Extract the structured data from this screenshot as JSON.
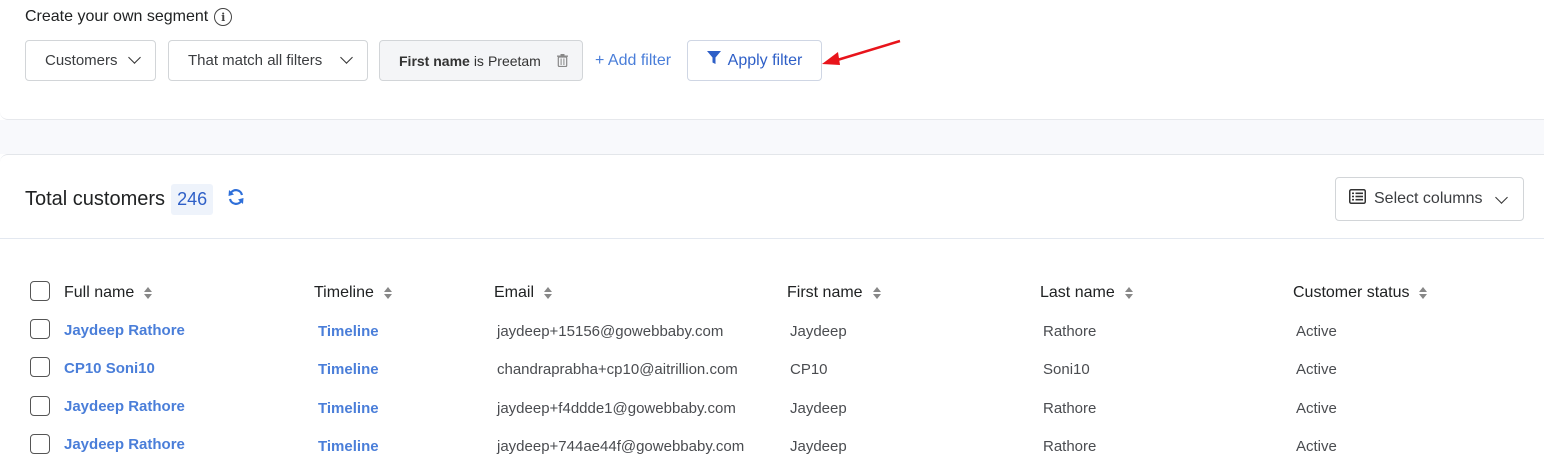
{
  "segment": {
    "title": "Create your own segment",
    "info_icon": "info-icon",
    "entity_dropdown": "Customers",
    "match_dropdown": "That match all filters",
    "filter_chip": {
      "field": "First name",
      "operator": "is",
      "value": "Preetam"
    },
    "add_filter": "+ Add filter",
    "apply_filter": "Apply filter"
  },
  "customers": {
    "title": "Total customers",
    "count": "246",
    "select_columns": "Select columns"
  },
  "table": {
    "headers": [
      "Full name",
      "Timeline",
      "Email",
      "First name",
      "Last name",
      "Customer status"
    ],
    "rows": [
      {
        "full_name": "Jaydeep Rathore",
        "timeline": "Timeline",
        "email": "jaydeep+15156@gowebbaby.com",
        "first_name": "Jaydeep",
        "last_name": "Rathore",
        "status": "Active"
      },
      {
        "full_name": "CP10 Soni10",
        "timeline": "Timeline",
        "email": "chandraprabha+cp10@aitrillion.com",
        "first_name": "CP10",
        "last_name": "Soni10",
        "status": "Active"
      },
      {
        "full_name": "Jaydeep Rathore",
        "timeline": "Timeline",
        "email": "jaydeep+f4ddde1@gowebbaby.com",
        "first_name": "Jaydeep",
        "last_name": "Rathore",
        "status": "Active"
      },
      {
        "full_name": "Jaydeep Rathore",
        "timeline": "Timeline",
        "email": "jaydeep+744ae44f@gowebbaby.com",
        "first_name": "Jaydeep",
        "last_name": "Rathore",
        "status": "Active"
      }
    ]
  },
  "colors": {
    "link": "#4a7ed9",
    "primary": "#2e5fc7",
    "annotation_arrow": "#e8141b"
  }
}
